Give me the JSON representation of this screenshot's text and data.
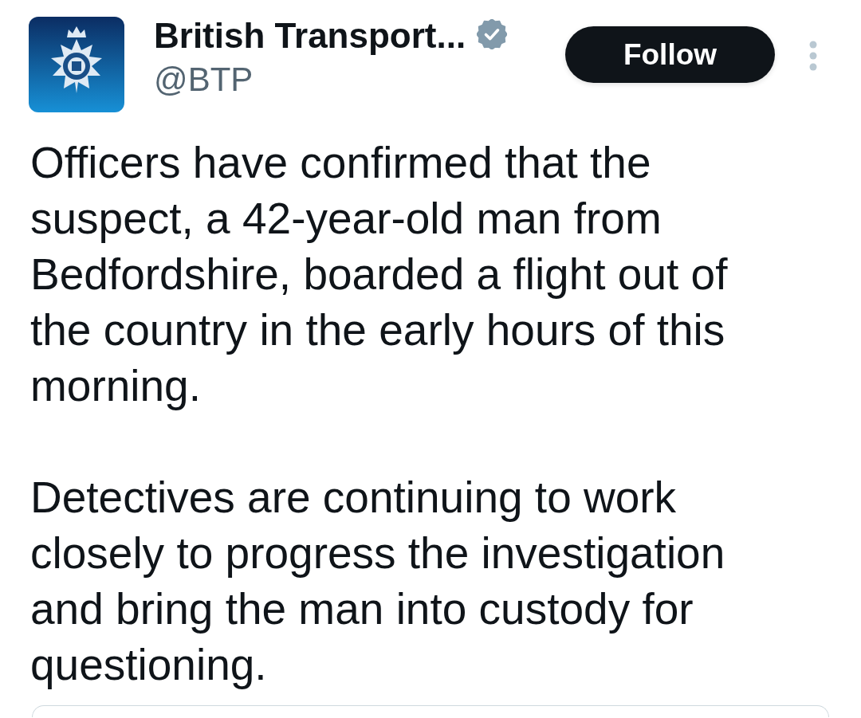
{
  "author": {
    "name": "British Transport...",
    "verified": true,
    "handle": "@BTP"
  },
  "follow_button": {
    "label": "Follow"
  },
  "post": {
    "paragraphs": [
      "Officers have confirmed that the suspect, a 42-year-old man from Bedfordshire, boarded a flight out of the country in the early hours of this morning.",
      "Detectives are continuing to work closely to progress the investigation and bring the man into custody for questioning."
    ]
  }
}
